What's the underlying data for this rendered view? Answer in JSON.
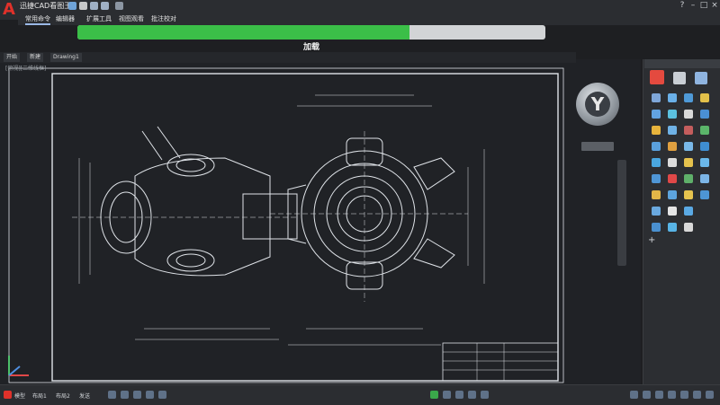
{
  "app": {
    "logo": "A",
    "title": "迅捷CAD看图王",
    "accent_color": "#e0312a"
  },
  "ribbon": {
    "tabs": [
      {
        "label": "常用命令"
      },
      {
        "label": "编辑器"
      },
      {
        "label": "扩展工具"
      },
      {
        "label": "视图观看"
      },
      {
        "label": "批注校对"
      }
    ]
  },
  "window_controls": {
    "help": "?",
    "minimize": "–",
    "maximize": "□",
    "close": "×"
  },
  "loading": {
    "label": "加载",
    "progress_percent": 71,
    "fill_color": "#3bbf48"
  },
  "file_tabs": [
    {
      "label": "开始"
    },
    {
      "label": "新建"
    },
    {
      "label": "Drawing1"
    }
  ],
  "drawing_label": "[俯视][二维线框]",
  "viewcube": {
    "face_letter": "Y"
  },
  "status_bar": {
    "coords": "模型",
    "layouts": [
      {
        "label": "布局1"
      },
      {
        "label": "布局2"
      },
      {
        "label": "发送"
      }
    ]
  }
}
